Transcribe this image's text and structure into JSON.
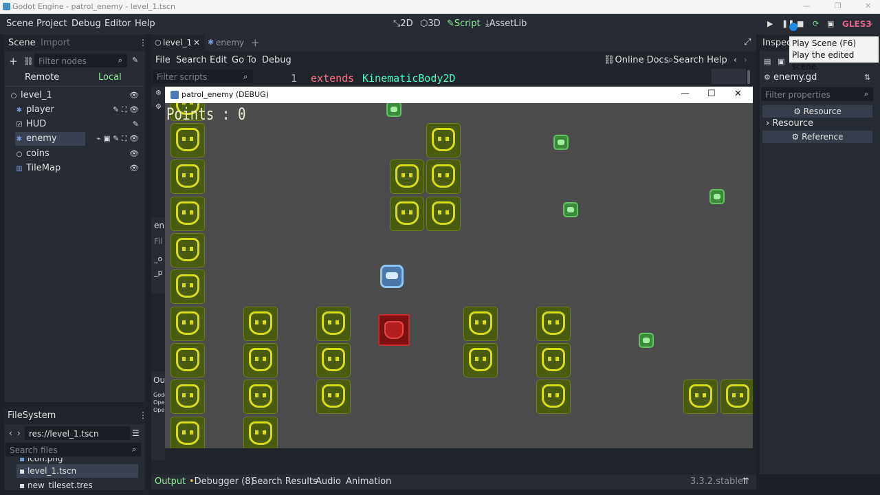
{
  "os_window": {
    "title": "Godot Engine - patrol_enemy - level_1.tscn"
  },
  "main_menu": {
    "items": [
      "Scene",
      "Project",
      "Debug",
      "Editor",
      "Help"
    ],
    "workspaces": [
      "2D",
      "3D",
      "Script",
      "AssetLib"
    ],
    "active_workspace": "Script",
    "renderer": "GLES3"
  },
  "scene_dock": {
    "tabs": [
      "Scene",
      "Import"
    ],
    "filter_placeholder": "Filter nodes",
    "remote_label": "Remote",
    "local_label": "Local",
    "nodes": [
      {
        "label": "level_1",
        "icon": "node2d-icon"
      },
      {
        "label": "player",
        "icon": "kinematic-body-icon"
      },
      {
        "label": "HUD",
        "icon": "canvas-layer-icon"
      },
      {
        "label": "enemy",
        "icon": "kinematic-body-icon"
      },
      {
        "label": "coins",
        "icon": "node2d-icon"
      },
      {
        "label": "TileMap",
        "icon": "tilemap-icon"
      }
    ],
    "selected_node": "enemy"
  },
  "filesystem_dock": {
    "title": "FileSystem",
    "path": "res://level_1.tscn",
    "search_placeholder": "Search files",
    "files": [
      "icon.png",
      "level_1.tscn",
      "new_tileset.tres"
    ],
    "selected_file": "level_1.tscn"
  },
  "editor": {
    "tabs": [
      "level_1",
      "enemy"
    ],
    "active_tab": "level_1",
    "menu": [
      "File",
      "Search",
      "Edit",
      "Go To",
      "Debug"
    ],
    "online_docs": "Online Docs",
    "search_help": "Search Help",
    "filter_scripts_placeholder": "Filter scripts",
    "line_number": "1",
    "code_keyword": "extends",
    "code_class": "KinematicBody2D",
    "side_fragments": [
      "en",
      "Fil",
      "_o",
      "_p",
      "Ou",
      "Godo",
      "Ope",
      "Ope"
    ]
  },
  "game_window": {
    "title": "patrol_enemy (DEBUG)",
    "points_label": "Points : 0",
    "tile_count": 30
  },
  "inspector": {
    "tab": "Inspec",
    "script_name": "enemy.gd",
    "filter_placeholder": "Filter properties",
    "rows": [
      "Resource",
      "Resource",
      "Reference"
    ]
  },
  "tooltip": {
    "title": "Play Scene (F6)",
    "description": "Play the edited scene."
  },
  "bottom_panel": {
    "tabs": [
      "Output",
      "Debugger (8)",
      "Search Results",
      "Audio",
      "Animation"
    ],
    "active_tab": "Output",
    "version": "3.3.2.stable"
  },
  "colors": {
    "accent": "#8eef97",
    "keyword": "#ff7085",
    "class": "#42ffc2",
    "renderer": "#e06487"
  }
}
